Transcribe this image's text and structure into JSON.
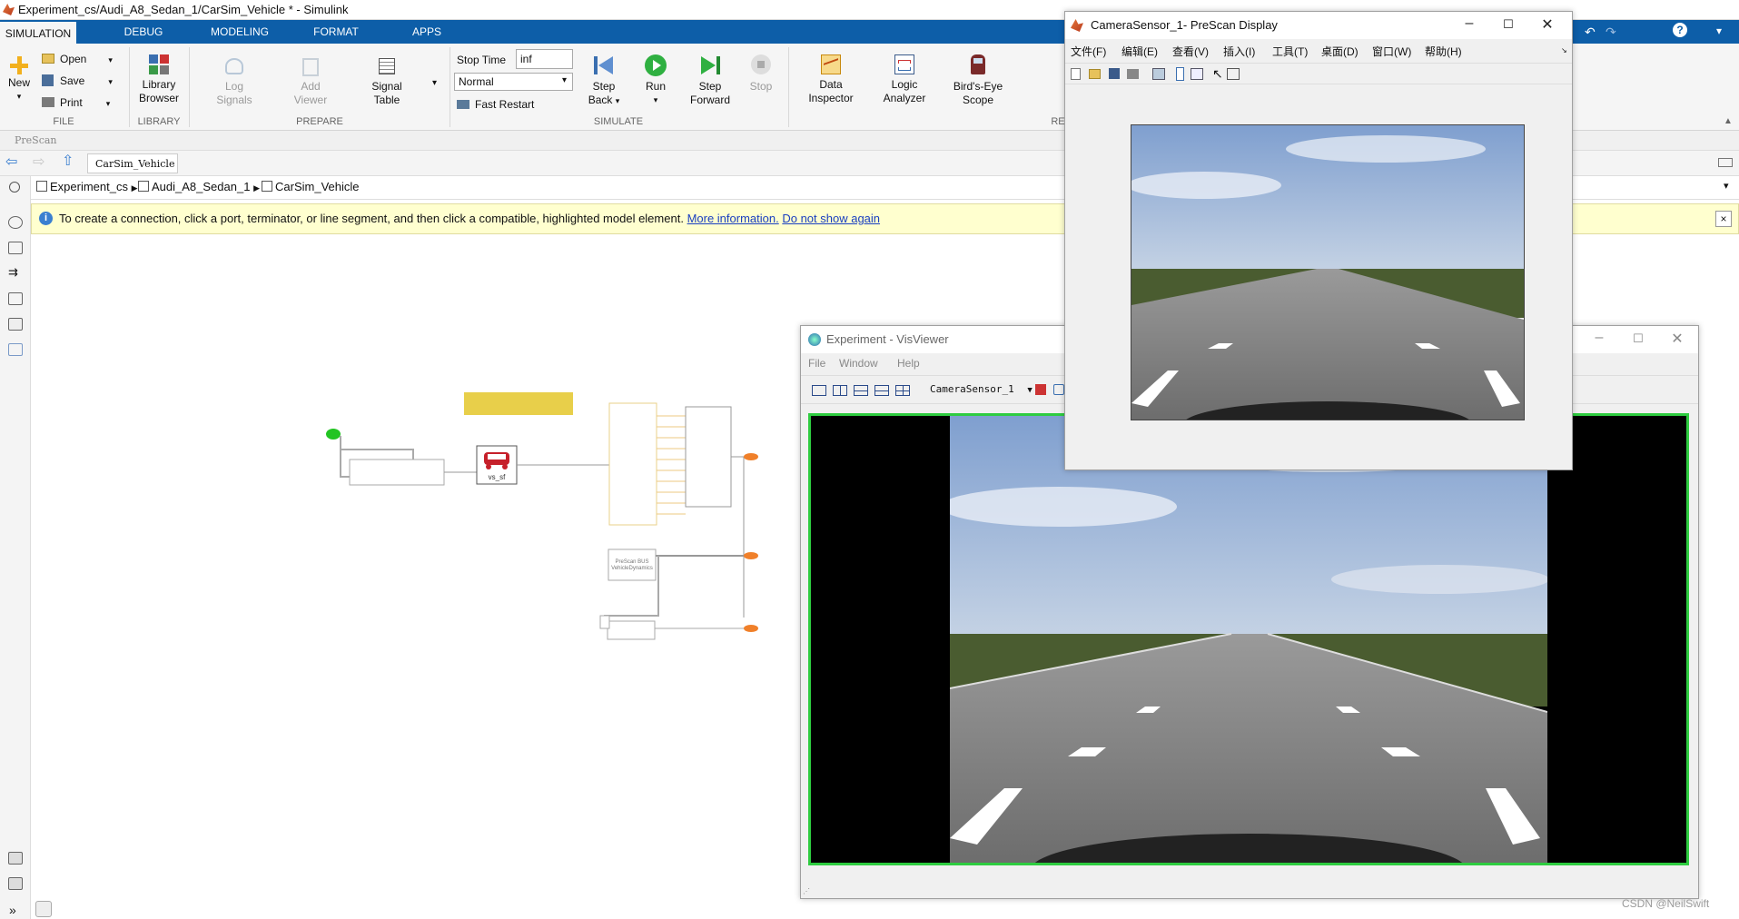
{
  "window": {
    "title": "Experiment_cs/Audi_A8_Sedan_1/CarSim_Vehicle * - Simulink"
  },
  "tabs": [
    "SIMULATION",
    "DEBUG",
    "MODELING",
    "FORMAT",
    "APPS"
  ],
  "ribbon": {
    "file": {
      "new": "New",
      "open": "Open",
      "save": "Save",
      "print": "Print",
      "group": "FILE"
    },
    "library": {
      "browser_line1": "Library",
      "browser_line2": "Browser",
      "group": "LIBRARY"
    },
    "prepare": {
      "log_line1": "Log",
      "log_line2": "Signals",
      "add_line1": "Add",
      "add_line2": "Viewer",
      "table_line1": "Signal",
      "table_line2": "Table",
      "group": "PREPARE"
    },
    "simulate": {
      "stop_time_label": "Stop Time",
      "stop_time_value": "inf",
      "mode": "Normal",
      "fast_restart": "Fast Restart",
      "step_back_line1": "Step",
      "step_back_line2": "Back",
      "run": "Run",
      "step_fwd_line1": "Step",
      "step_fwd_line2": "Forward",
      "stop": "Stop",
      "group": "SIMULATE"
    },
    "review": {
      "data_line1": "Data",
      "data_line2": "Inspector",
      "logic_line1": "Logic",
      "logic_line2": "Analyzer",
      "bird_line1": "Bird's-Eye",
      "bird_line2": "Scope",
      "group_partial": "RE"
    }
  },
  "prescan_bar": "PreScan",
  "model_tab": "CarSim_Vehicle",
  "breadcrumb": [
    "Experiment_cs",
    "Audi_A8_Sedan_1",
    "CarSim_Vehicle"
  ],
  "notice": {
    "text": "To create a connection, click a port, terminator, or line segment, and then click a compatible, highlighted model element.",
    "link1": "More information.",
    "link2": "Do not show again"
  },
  "model": {
    "vs_block": "vs_sf",
    "bus_block_line1": "PreScan BUS",
    "bus_block_line2": "VehicleDynamics"
  },
  "camera_window": {
    "title": "CameraSensor_1- PreScan Display",
    "menu": [
      "文件(F)",
      "编辑(E)",
      "查看(V)",
      "插入(I)",
      "工具(T)",
      "桌面(D)",
      "窗口(W)",
      "帮助(H)"
    ]
  },
  "visviewer": {
    "title": "Experiment - VisViewer",
    "menu": [
      "File",
      "Window",
      "Help"
    ],
    "sensor_select": "CameraSensor_1"
  },
  "watermark": "CSDN @NeilSwift",
  "colors": {
    "tab_blue": "#0d5ea8",
    "notice_bg": "#ffffcf",
    "view_border": "#2ecc40",
    "port_orange": "#f0802a",
    "car_red": "#c6202a"
  }
}
